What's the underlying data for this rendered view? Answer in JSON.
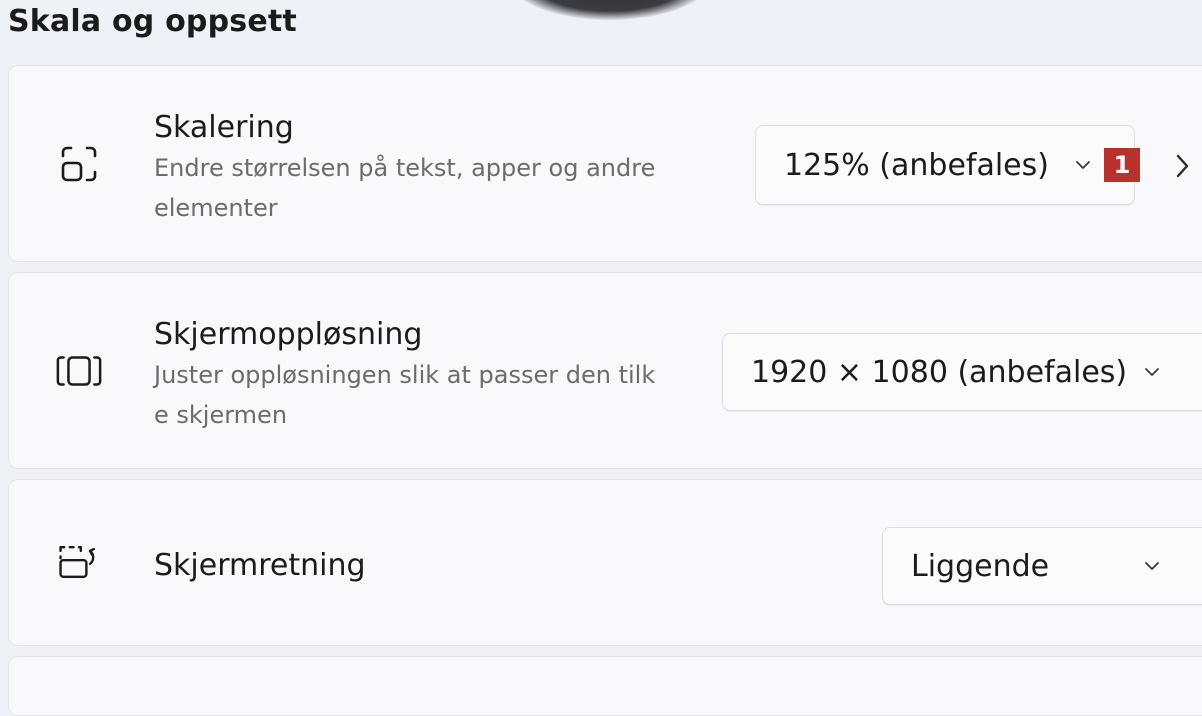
{
  "section": {
    "title": "Skala og oppsett"
  },
  "rows": [
    {
      "icon": "scale-icon",
      "title": "Skalering",
      "description": "Endre størrelsen på tekst, apper og andre\nelementer",
      "dropdown_value": "125% (anbefales)",
      "badge": "1"
    },
    {
      "icon": "resolution-icon",
      "title": "Skjermoppløsning",
      "description": "Juster oppløsningen slik at passer den tilk\ne skjermen",
      "dropdown_value": "1920 × 1080 (anbefales)"
    },
    {
      "icon": "orientation-icon",
      "title": "Skjermretning",
      "dropdown_value": "Liggende"
    }
  ],
  "colors": {
    "background": "#eef1f6",
    "card": "#f9f9fb",
    "badge": "#b9312c",
    "secondary_text": "#6b6b70"
  }
}
